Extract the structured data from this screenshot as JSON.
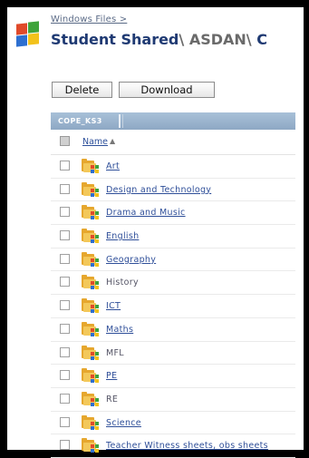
{
  "header": {
    "breadcrumb": "Windows Files >",
    "title_part1": "Student Shared",
    "sep1": "\\",
    "title_part2": "ASDAN",
    "sep2": "\\",
    "title_part3": "C"
  },
  "toolbar": {
    "delete_label": "Delete",
    "download_label": "Download"
  },
  "tab": {
    "label": "COPE_KS3"
  },
  "list": {
    "name_header": "Name",
    "sort_indicator": "▲",
    "items": [
      {
        "label": "Art",
        "link": true
      },
      {
        "label": "Design and Technology",
        "link": true
      },
      {
        "label": "Drama and Music",
        "link": true
      },
      {
        "label": "English",
        "link": true
      },
      {
        "label": "Geography",
        "link": true
      },
      {
        "label": "History",
        "link": false
      },
      {
        "label": "ICT",
        "link": true
      },
      {
        "label": "Maths",
        "link": true
      },
      {
        "label": "MFL",
        "link": false
      },
      {
        "label": "PE",
        "link": true
      },
      {
        "label": "RE",
        "link": false
      },
      {
        "label": "Science",
        "link": true
      },
      {
        "label": "Teacher Witness sheets, obs sheets",
        "link": true
      }
    ]
  },
  "colors": {
    "title": "#1f3a73",
    "link": "#2f4f99",
    "tabbar": "#8ea8c4",
    "folder": "#e6a72e"
  },
  "icons": {
    "logo": "windows-logo-icon",
    "folder": "windows-folder-icon",
    "checkbox": "checkbox-icon"
  }
}
